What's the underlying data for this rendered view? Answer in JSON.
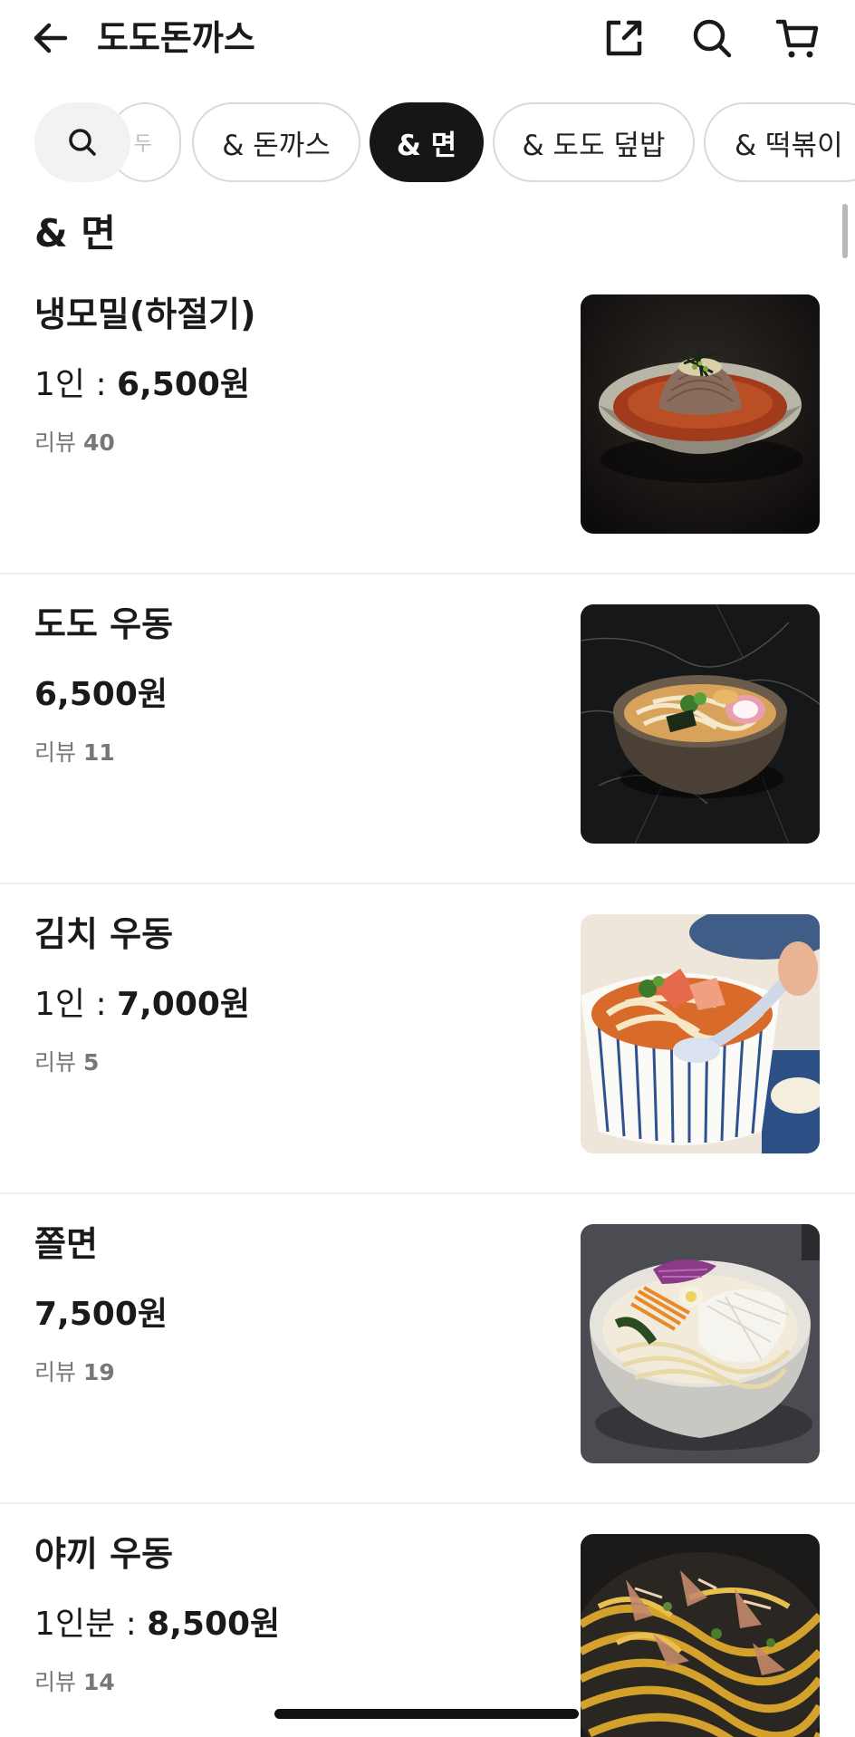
{
  "header": {
    "title": "도도돈까스",
    "back_icon": "arrow-left-icon",
    "share_icon": "share-icon",
    "search_icon": "search-icon",
    "cart_icon": "cart-icon"
  },
  "categories": {
    "search_icon": "search-icon",
    "partial_chip": "두",
    "items": [
      {
        "label": "& 돈까스",
        "active": false
      },
      {
        "label": "& 면",
        "active": true
      },
      {
        "label": "& 도도 덮밥",
        "active": false
      },
      {
        "label": "& 떡볶이",
        "active": false
      }
    ]
  },
  "section": {
    "title": "& 면"
  },
  "menu_items": [
    {
      "name": "냉모밀(하절기)",
      "price_unit": "1인 : ",
      "price": "6,500원",
      "review_label": "리뷰",
      "review_count": "40",
      "image": "cold-soba-photo"
    },
    {
      "name": "도도 우동",
      "price_unit": "",
      "price": "6,500원",
      "review_label": "리뷰",
      "review_count": "11",
      "image": "udon-photo"
    },
    {
      "name": "김치 우동",
      "price_unit": "1인 : ",
      "price": "7,000원",
      "review_label": "리뷰",
      "review_count": "5",
      "image": "kimchi-udon-photo"
    },
    {
      "name": "쫄면",
      "price_unit": "",
      "price": "7,500원",
      "review_label": "리뷰",
      "review_count": "19",
      "image": "jjolmyeon-photo"
    },
    {
      "name": "야끼 우동",
      "price_unit": "1인분 : ",
      "price": "8,500원",
      "review_label": "리뷰",
      "review_count": "14",
      "image": "yaki-udon-photo"
    }
  ],
  "colors": {
    "active_chip": "#161616",
    "divider": "#eeeeee",
    "review_text": "#777777"
  }
}
